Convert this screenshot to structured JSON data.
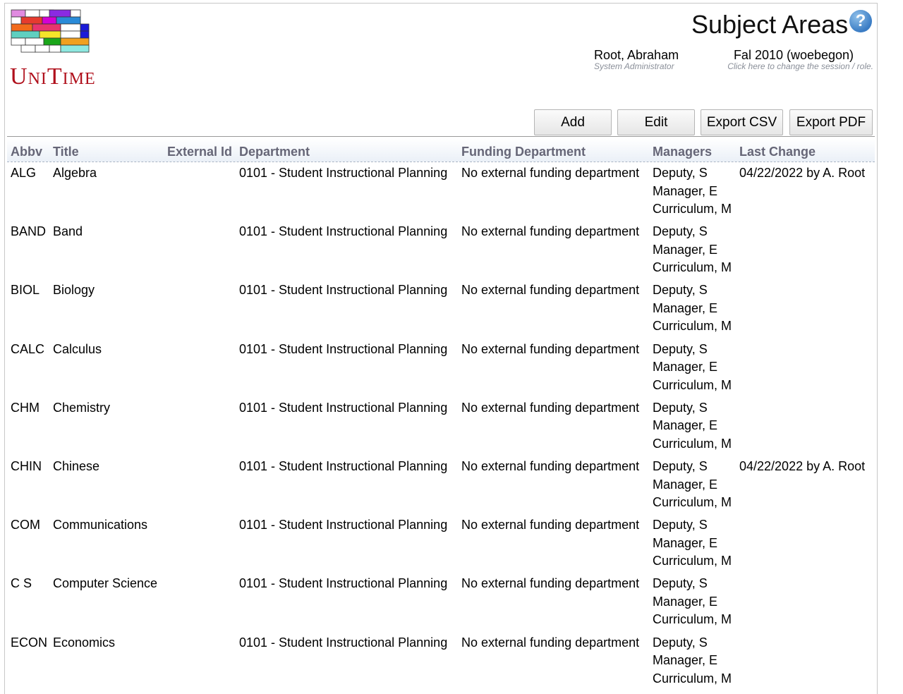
{
  "header": {
    "logo_text": "UniTime",
    "page_title": "Subject Areas",
    "user_name": "Root, Abraham",
    "user_role": "System Administrator",
    "session_name": "Fal 2010 (woebegon)",
    "session_hint": "Click here to change the session / role."
  },
  "toolbar": {
    "add": "Add",
    "edit": "Edit",
    "export_csv": "Export CSV",
    "export_pdf": "Export PDF"
  },
  "table": {
    "columns": [
      "Abbv",
      "Title",
      "External Id",
      "Department",
      "Funding Department",
      "Managers",
      "Last Change"
    ],
    "rows": [
      {
        "abbv": "ALG",
        "title": "Algebra",
        "external_id": "",
        "department": "0101 - Student Instructional Planning",
        "funding": "No external funding department",
        "managers": [
          "Deputy, S",
          "Manager, E",
          "Curriculum, M"
        ],
        "last_change": "04/22/2022 by A. Root"
      },
      {
        "abbv": "BAND",
        "title": "Band",
        "external_id": "",
        "department": "0101 - Student Instructional Planning",
        "funding": "No external funding department",
        "managers": [
          "Deputy, S",
          "Manager, E",
          "Curriculum, M"
        ],
        "last_change": ""
      },
      {
        "abbv": "BIOL",
        "title": "Biology",
        "external_id": "",
        "department": "0101 - Student Instructional Planning",
        "funding": "No external funding department",
        "managers": [
          "Deputy, S",
          "Manager, E",
          "Curriculum, M"
        ],
        "last_change": ""
      },
      {
        "abbv": "CALC",
        "title": "Calculus",
        "external_id": "",
        "department": "0101 - Student Instructional Planning",
        "funding": "No external funding department",
        "managers": [
          "Deputy, S",
          "Manager, E",
          "Curriculum, M"
        ],
        "last_change": ""
      },
      {
        "abbv": "CHM",
        "title": "Chemistry",
        "external_id": "",
        "department": "0101 - Student Instructional Planning",
        "funding": "No external funding department",
        "managers": [
          "Deputy, S",
          "Manager, E",
          "Curriculum, M"
        ],
        "last_change": ""
      },
      {
        "abbv": "CHIN",
        "title": "Chinese",
        "external_id": "",
        "department": "0101 - Student Instructional Planning",
        "funding": "No external funding department",
        "managers": [
          "Deputy, S",
          "Manager, E",
          "Curriculum, M"
        ],
        "last_change": "04/22/2022 by A. Root"
      },
      {
        "abbv": "COM",
        "title": "Communications",
        "external_id": "",
        "department": "0101 - Student Instructional Planning",
        "funding": "No external funding department",
        "managers": [
          "Deputy, S",
          "Manager, E",
          "Curriculum, M"
        ],
        "last_change": ""
      },
      {
        "abbv": "C S",
        "title": "Computer Science",
        "external_id": "",
        "department": "0101 - Student Instructional Planning",
        "funding": "No external funding department",
        "managers": [
          "Deputy, S",
          "Manager, E",
          "Curriculum, M"
        ],
        "last_change": ""
      },
      {
        "abbv": "ECON",
        "title": "Economics",
        "external_id": "",
        "department": "0101 - Student Instructional Planning",
        "funding": "No external funding department",
        "managers": [
          "Deputy, S",
          "Manager, E",
          "Curriculum, M"
        ],
        "last_change": ""
      }
    ]
  }
}
